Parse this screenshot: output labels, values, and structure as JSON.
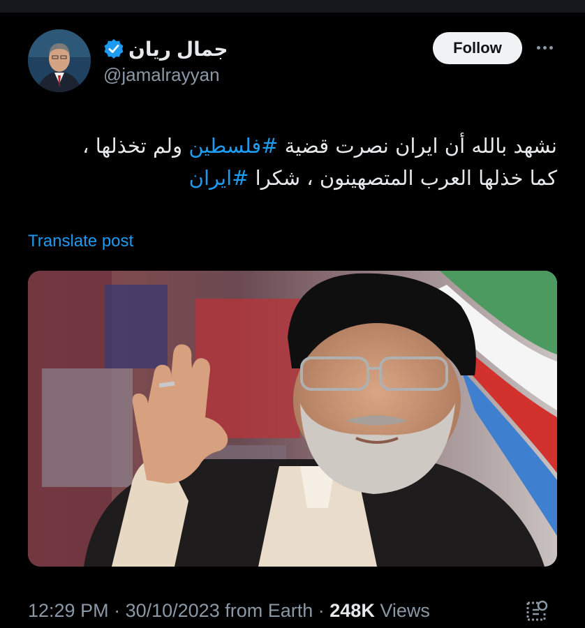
{
  "author": {
    "display_name": "جمال ريان",
    "handle": "@jamalrayyan",
    "verified_icon": "verified-badge-icon",
    "avatar": "avatar"
  },
  "actions": {
    "follow_label": "Follow",
    "more_icon": "more-options-icon"
  },
  "tweet": {
    "line1_start": "نشهد بالله أن ايران نصرت قضية ",
    "hashtag1": "#فلسطين",
    "line1_end": " ولم تخذلها ،",
    "line2_start": "كما خذلها العرب المتصهينون ، شكرا ",
    "hashtag2": "#ايران"
  },
  "translate_label": "Translate post",
  "meta": {
    "time": "12:29 PM",
    "sep1": " · ",
    "date": "30/10/2023",
    "source": " from Earth",
    "sep2": " · ",
    "views_count": "248K",
    "views_label": " Views"
  },
  "colors": {
    "background": "#000000",
    "accent": "#1d9bf0",
    "secondary_text": "#8b98a5",
    "follow_bg": "#eff3f4"
  }
}
